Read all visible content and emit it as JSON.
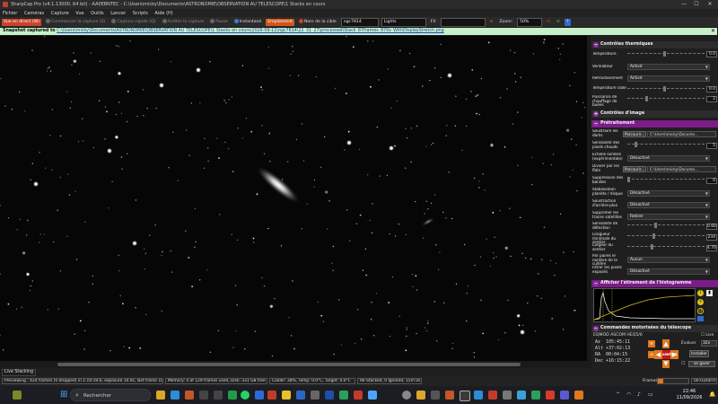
{
  "window": {
    "title": "SharpCap Pro (v4.1.13000, 64 bit) - AA0EBNTEC - C:\\Users\\micky\\Documents\\ASTRONOMIE\\OBSERVATION AU TELESCOPE\\1 Stacks en cours",
    "minimize": "—",
    "maximize": "☐",
    "close": "✕"
  },
  "menu": [
    "Fichier",
    "Caméras",
    "Capture",
    "Vue",
    "Outils",
    "Lancer",
    "Scripts",
    "Aide (H)"
  ],
  "toolbar": {
    "live": "Vue en direct (W)",
    "start_capture": "Commencer la capture (S)",
    "quick_capture": "Capture rapide (Q)",
    "stop_capture": "Arrêter la capture",
    "pause": "Pause",
    "snapshot": "Instantané",
    "stacking": "Empilement",
    "target_label": "Nom de la cible",
    "target_value": "ngc7814",
    "frame_type": "Lights",
    "fx_label": "FX",
    "fx_value": "",
    "zoom_label": "Zoom:",
    "zoom_value": "50%"
  },
  "notification": {
    "prefix": "Snapshot captured to",
    "path": "C:\\Users\\micky\\Documents\\ASTRONOMIE\\OBSERVATION AU TELESCOPE\\1 Stacks en cours\\2026-09-11\\ngc7814\\22_31_27\\processed\\Stack_87frames_870s_WithDisplayStretch.png",
    "close": "✕"
  },
  "panel": {
    "thermal_title": "Contrôles thermiques",
    "thermal": [
      {
        "label": "Température",
        "value": "0.0",
        "kind": "slider"
      },
      {
        "label": "Ventilateur",
        "value": "Activé",
        "kind": "drop"
      },
      {
        "label": "Refroidissement",
        "value": "Activé",
        "kind": "drop"
      },
      {
        "label": "Température cible",
        "value": "0.0",
        "kind": "slider"
      },
      {
        "label": "Puissance de chauffage de buées",
        "value": "2",
        "kind": "slider"
      }
    ],
    "image_title": "Contrôles d'image",
    "pretreat_title": "Prétraitement",
    "pretreat": [
      {
        "label": "Soustraire les darks",
        "value": "C:\\Users\\micky\\Docume...",
        "kind": "browse"
      },
      {
        "label": "Sensibilité des pixels chauds",
        "value": "5",
        "kind": "slider"
      },
      {
        "label": "Échelle sombre (expérimentale)",
        "value": "Désactivé",
        "kind": "drop"
      },
      {
        "label": "Diviser par les flats",
        "value": "C:\\Users\\micky\\Docume...",
        "kind": "browse"
      },
      {
        "label": "Suppression des bandes",
        "value": "0",
        "kind": "slider"
      },
      {
        "label": "Stabilisation planète / disque",
        "value": "Désactivé",
        "kind": "drop"
      },
      {
        "label": "Soustraction d'arrière-plan",
        "value": "Désactivé",
        "kind": "drop"
      },
      {
        "label": "Supprimer les traces satellites",
        "value": "Retirer",
        "kind": "drop"
      },
      {
        "label": "Sensibilité de détection",
        "value": "0.60",
        "kind": "slider"
      },
      {
        "label": "Longueur minimale du sentier",
        "value": "234",
        "kind": "slider"
      },
      {
        "label": "Largeur du sentier",
        "value": "4.70",
        "kind": "slider"
      },
      {
        "label": "Par paires le nombre de la cuillère",
        "value": "Aucun",
        "kind": "drop"
      },
      {
        "label": "Filtrer les pixels exposés",
        "value": "Désactivé",
        "kind": "drop"
      }
    ],
    "histogram_title": "Afficher l'étirement de l'histogramme",
    "scope_title": "Commandes motorisées du télescope",
    "scope_device": "EQMOD ASCOM HEQ5/6",
    "live_cb": "Live",
    "az_label": "Az",
    "az_value": "105:45:11",
    "alt_label": "Alt",
    "alt_value": "+37:02:13",
    "ra_label": "RA",
    "ra_value": "00:04:15",
    "dec_label": "Dec",
    "dec_value": "+16:15:22",
    "eval_label": "Évaluer",
    "eval_value": "32x",
    "install_btn": "Installer",
    "park_btn": "se garer",
    "stop_btn": "ARRÊTER"
  },
  "livetab": "Live Stacking",
  "status": {
    "preview": "Previewing : 424 frames (0 dropped) in 1:10:19.6, exposure 10.0s, last frame 10.0s",
    "memory": "Memory: 4 of 129 frames used, Disk: 331 GB free",
    "cooler": "Cooler: 28%, Temp: 0.0°C, Target: 0.0°C",
    "stacked": "90 Stacked, 0 Ignored, 15m 0s",
    "frames_label": "Frames:",
    "timer": "00:03/00:07"
  },
  "taskbar": {
    "search": "Rechercher",
    "time": "22:46",
    "date": "11/09/2026"
  },
  "colors": {
    "stacking_btn": "#d1561c",
    "live_btn": "#c9422b",
    "section_purple": "#7c1c88",
    "notif_bg": "#c8f0c8"
  }
}
